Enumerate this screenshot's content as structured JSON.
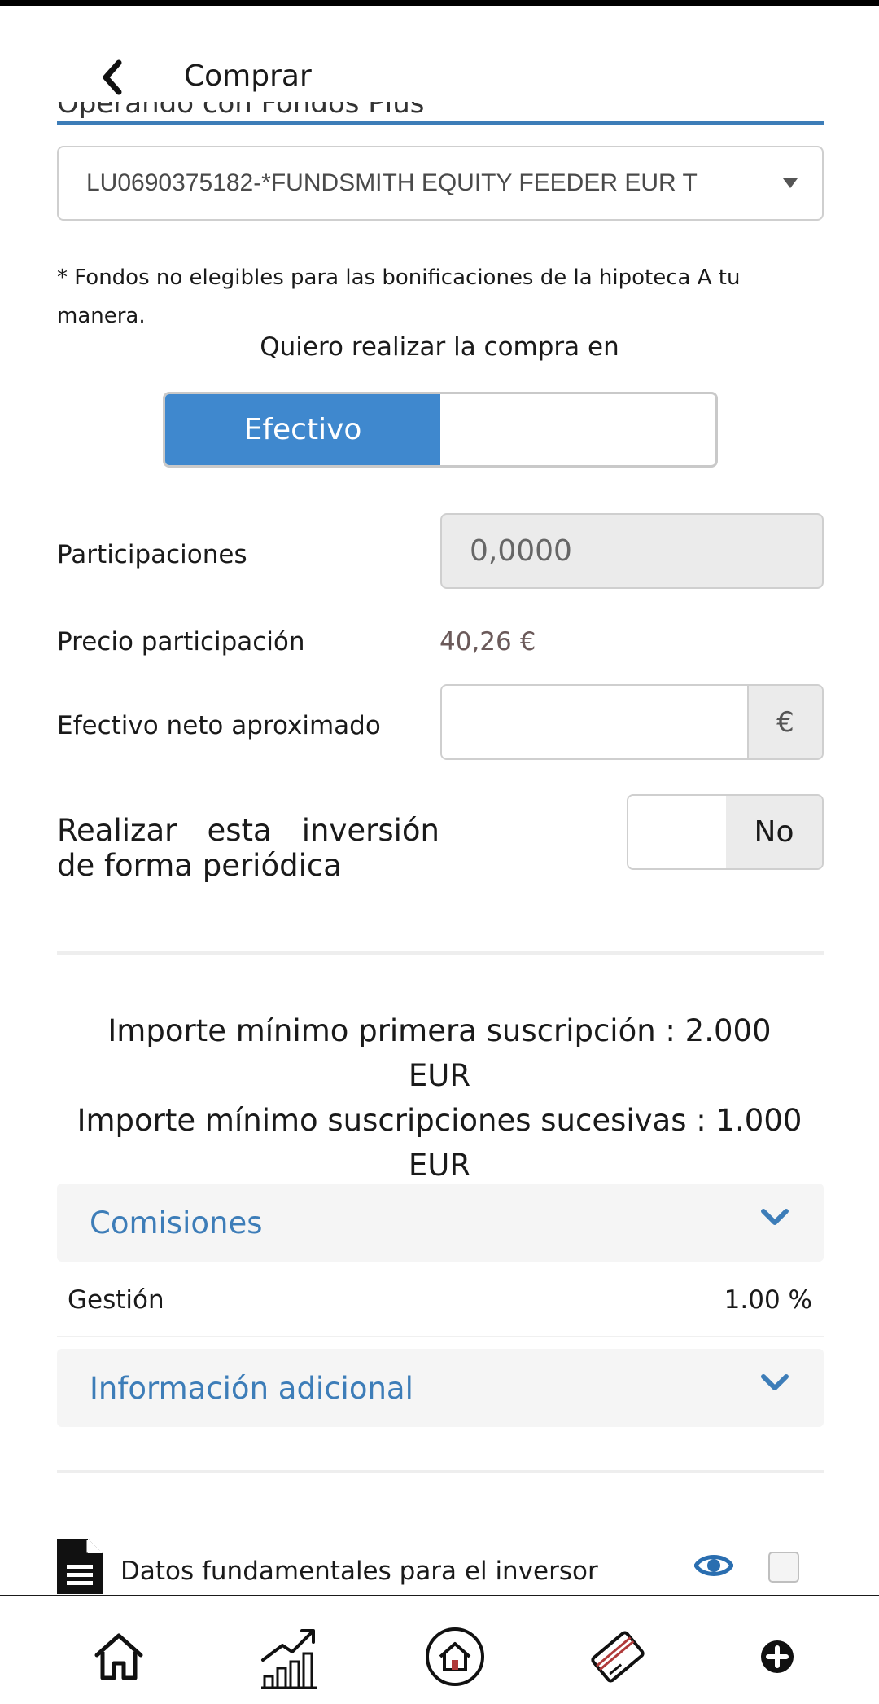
{
  "header": {
    "title": "Comprar",
    "cut_label": "Operando con Fondos Plus"
  },
  "fund_select": {
    "value": "LU0690375182-*FUNDSMITH EQUITY FEEDER EUR T"
  },
  "note": "* Fondos no elegibles para las bonificaciones de la hipoteca A tu manera.",
  "buy_in": {
    "label": "Quiero realizar la compra en",
    "options": [
      "Efectivo",
      ""
    ],
    "selected": "Efectivo"
  },
  "participaciones": {
    "label": "Participaciones",
    "value": "0,0000"
  },
  "precio": {
    "label": "Precio participación",
    "value": "40,26 €"
  },
  "efectivo_neto": {
    "label": "Efectivo neto aproximado",
    "value": "",
    "currency": "€"
  },
  "periodic": {
    "label": "Realizar esta inversión de forma periódica",
    "toggle_value": "No"
  },
  "minimums": {
    "line1": "Importe mínimo primera suscripción : 2.000 EUR",
    "line2": "Importe mínimo suscripciones sucesivas : 1.000 EUR"
  },
  "comisiones": {
    "title": "Comisiones",
    "rows": [
      {
        "label": "Gestión",
        "value": "1.00 %"
      }
    ]
  },
  "info_adicional": {
    "title": "Información adicional"
  },
  "document": {
    "label": "Datos fundamentales para el inversor"
  },
  "colors": {
    "accent": "#3f88ce",
    "link": "#3d7db8",
    "panel_bg": "#f5f5f5",
    "disabled_bg": "#ebebeb"
  },
  "bottom_nav": {
    "items": [
      "home-icon",
      "investments-chart-icon",
      "mortgage-house-icon",
      "cards-icon",
      "more-plus-icon"
    ]
  }
}
